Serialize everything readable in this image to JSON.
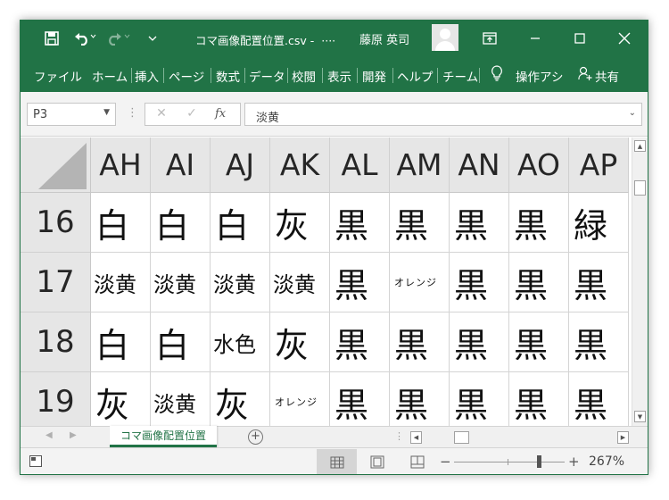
{
  "titlebar": {
    "filename": "コマ画像配置位置.csv",
    "ellipsis": "····",
    "user": "藤原 英司",
    "icons": [
      "save-icon",
      "undo-icon",
      "redo-icon",
      "customize-qat-icon",
      "ribbon-display-options-icon",
      "minimize-icon",
      "maximize-icon",
      "close-icon"
    ]
  },
  "ribbon": {
    "tabs": [
      "ファイル",
      "ホーム",
      "挿入",
      "ページ",
      "数式",
      "データ",
      "校閲",
      "表示",
      "開発",
      "ヘルプ",
      "チーム",
      "操作アシ",
      "共有"
    ]
  },
  "formula_bar": {
    "name_box": "P3",
    "content": "淡黄"
  },
  "sheet": {
    "columns": [
      "AH",
      "AI",
      "AJ",
      "AK",
      "AL",
      "AM",
      "AN",
      "AO",
      "AP"
    ],
    "rows": [
      {
        "num": "16",
        "cells": [
          "白",
          "白",
          "白",
          "灰",
          "黒",
          "黒",
          "黒",
          "黒",
          "緑"
        ]
      },
      {
        "num": "17",
        "cells": [
          "淡黄",
          "淡黄",
          "淡黄",
          "淡黄",
          "黒",
          "オレンジ",
          "黒",
          "黒",
          "黒"
        ]
      },
      {
        "num": "18",
        "cells": [
          "白",
          "白",
          "水色",
          "灰",
          "黒",
          "黒",
          "黒",
          "黒",
          "黒"
        ]
      },
      {
        "num": "19",
        "cells": [
          "灰",
          "淡黄",
          "灰",
          "オレンジ",
          "黒",
          "黒",
          "黒",
          "黒",
          "黒"
        ]
      }
    ]
  },
  "sheet_tabs": {
    "active": "コマ画像配置位置",
    "add_symbol": "+"
  },
  "statusbar": {
    "zoom": "267%",
    "minus": "−",
    "plus": "+"
  },
  "colors": {
    "accent": "#217346",
    "header_bg": "#e6e6e6",
    "gridline": "#d4d4d4"
  }
}
